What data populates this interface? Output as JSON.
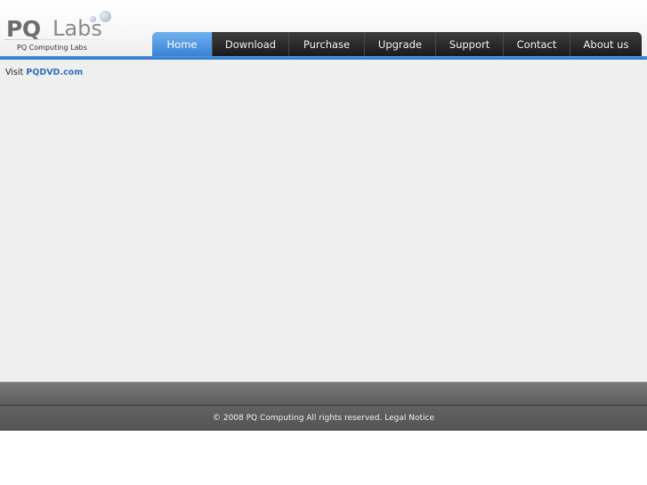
{
  "logo": {
    "mark": "PQ",
    "word": "Labs",
    "tagline": "PQ Computing Labs"
  },
  "nav": {
    "items": [
      {
        "label": "Home",
        "active": true
      },
      {
        "label": "Download",
        "active": false
      },
      {
        "label": "Purchase",
        "active": false
      },
      {
        "label": "Upgrade",
        "active": false
      },
      {
        "label": "Support",
        "active": false
      },
      {
        "label": "Contact",
        "active": false
      },
      {
        "label": "About us",
        "active": false
      }
    ]
  },
  "content": {
    "visit_prefix": "Visit",
    "visit_link": "PQDVD.com"
  },
  "footer": {
    "copyright": "© 2008 PQ Computing All rights reserved.",
    "legal_link": "Legal Notice"
  },
  "colors": {
    "accent_blue": "#3a83d4",
    "nav_dark": "#1a1a1a",
    "content_bg": "#efefef",
    "footer_bg": "#5d5d5d",
    "link_blue": "#2e6fbf"
  }
}
